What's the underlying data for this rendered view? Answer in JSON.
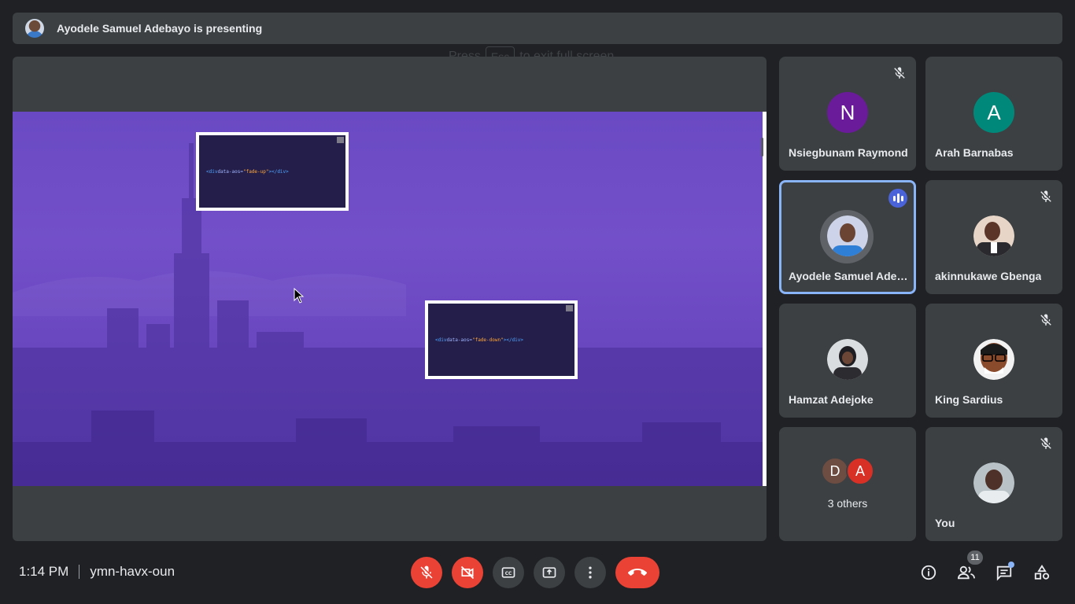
{
  "banner": {
    "presenter_text": "Ayodele Samuel Adebayo is presenting"
  },
  "esc_hint": {
    "pre": "Press",
    "key": "Esc",
    "post": "to exit full screen"
  },
  "slide": {
    "code_boxes": [
      {
        "tag_open": "<div ",
        "attr": "data-aos=",
        "value": "\"fade-up\"",
        "tag_close": "></div>"
      },
      {
        "tag_open": "<div ",
        "attr": "data-aos=",
        "value": "\"fade-down\"",
        "tag_close": "></div>"
      }
    ]
  },
  "participants": [
    {
      "name": "Nsiegbunam Raymond",
      "avatar_letter": "N",
      "avatar_color": "#6a1b9a",
      "muted": true
    },
    {
      "name": "Arah Barnabas",
      "avatar_letter": "A",
      "avatar_color": "#00897b",
      "muted": false
    },
    {
      "name": "Ayodele Samuel Ade…",
      "speaking": true,
      "active": true
    },
    {
      "name": "akinnukawe Gbenga",
      "muted": true
    },
    {
      "name": "Hamzat Adejoke",
      "muted": false
    },
    {
      "name": "King Sardius",
      "muted": true
    },
    {
      "others_label": "3 others",
      "others_letters": [
        "D",
        "A"
      ]
    },
    {
      "name": "You",
      "muted": true
    }
  ],
  "meeting": {
    "time": "1:14 PM",
    "code": "ymn-havx-oun"
  },
  "controls": [
    "mic-off",
    "camera-off",
    "captions",
    "present-now",
    "more-options",
    "leave-call"
  ],
  "right_controls": {
    "people_count": "11"
  },
  "colors": {
    "background": "#202124",
    "tile": "#3c4043",
    "danger": "#ea4335",
    "accent": "#8ab4f8"
  }
}
